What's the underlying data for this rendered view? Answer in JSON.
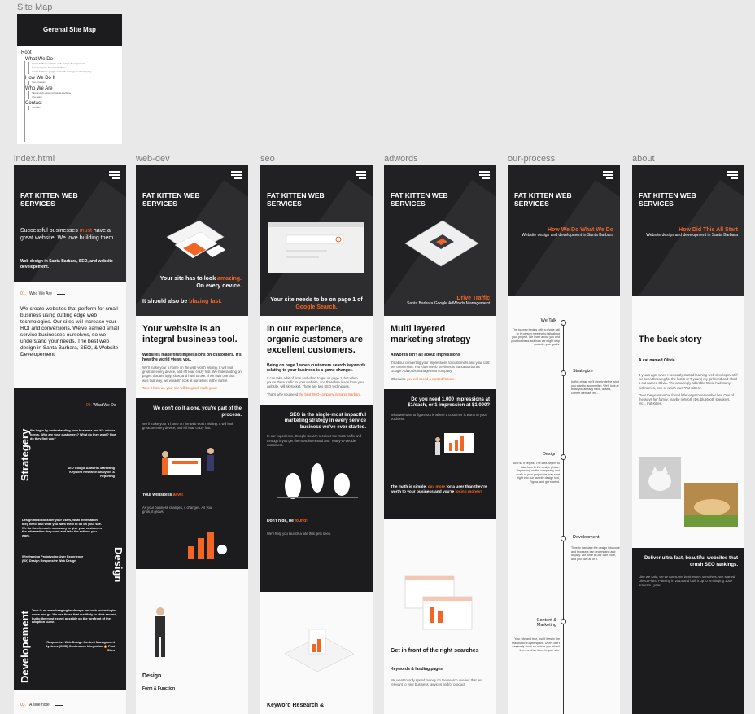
{
  "frames": {
    "site_map_label": "Site Map",
    "index_label": "index.html",
    "webdev_label": "web-dev",
    "seo_label": "seo",
    "adwords_label": "adwords",
    "process_label": "our-process",
    "about_label": "about"
  },
  "sitemap": {
    "title": "Gerenal Site Map",
    "root": "Root",
    "sections": [
      {
        "title": "What We Do",
        "pages": [
          "/santa-barbara-custom-web-design-development",
          "/seo-company-in-santa-barbara",
          "/santa-barbara-google-adwords-management-company"
        ]
      },
      {
        "title": "How We Do It",
        "pages": [
          "/our-process"
        ]
      },
      {
        "title": "Who We Are",
        "pages": [
          "/about-web-design-in-santa-barbara",
          "/the-team"
        ]
      },
      {
        "title": "Contact",
        "pages": [
          "/contact"
        ]
      }
    ]
  },
  "brand": {
    "name": "FAT KITTEN WEB SERVICES",
    "accent": "#f26522",
    "dark": "#1c1c1e"
  },
  "index": {
    "hero_lead_1": "Successful businesses ",
    "hero_lead_hl": "must",
    "hero_lead_2": " have a great website.  We love building them.",
    "hero_sub": "Web design in Santa Barbara, SEO, and website developement.",
    "s1_num": "01.",
    "s1_title": "Who We Are",
    "s1_text": "We create websites that perform for small business using cutting edge web technologies.  Our sites will increase your ROI and conversions.  We've earned small service businesses ourselves, so we understand your needs.  The best web design in Santa Barbara, SEO, & Website Developement.",
    "s2_num": "02.",
    "s2_title": "What We Do",
    "strategy": "Strategery",
    "design": "Design",
    "development": "Developement",
    "s3_num": "03.",
    "s3_title": "A side note",
    "strategy_text": "We begin by understanding your business and it's unique needs.  Who are your customers? What do they want?  How do they find you?",
    "strategy_list": "SEO Google Adwords Marketing Keyword Research Analytics & Reporting",
    "design_text": "Design must consider your users, what information they need, and what you want them to do on your site.  We do the elements necessary to give your customers the information they need and take the actions you want.",
    "design_list": "Wireframing Prototyping User Experience (UX) Design Responsive Web Design",
    "dev_text": "Tech is an everchanging landscape and web technologies come and go.  We use those that are likely to stick around, but to the most extent possible on the forefront of the adoption curve.",
    "dev_list": "Responsive Web Design Content Management Systems (CMS) Continuous Integration 🔥 Fast Sites"
  },
  "webdev": {
    "caption_1": "Your site has to look ",
    "caption_hl": "amazing.",
    "caption_2": "On every device.",
    "caption_3": "It should also be ",
    "caption_3_hl": "blazing fast.",
    "heading": "Your website is an integral business tool.",
    "sub": "Websites make first impressions on customers.  It's how the world views you.",
    "para": "We'll make your a home on the web worth visiting.  It will look great on every device, and it'll load crazy fast.  We hate landing on pages that are ugly, slow, and hard to use.  If we built one that was that way, we wouldn't look at ourselves in the mirror.",
    "link": "Take it from us, your site will be good, really good.",
    "dark_title": "We don't do it alone, you're part of the process.",
    "dark_text": "We'll make your a home on the web worth visiting.  It will look great on every device, and it'll load crazy fast.",
    "alive_1": "Your website is ",
    "alive_hl": "alive!",
    "alive_text": "As your business changes, it changes.  As you grow, it grows.",
    "design_title": "Design",
    "form_title": "Form & Function"
  },
  "seo": {
    "caption_1": "Your site needs to be on page 1 of ",
    "caption_hl": "Google Search.",
    "heading": "In our experience, organic customers are excellent customers.",
    "sub": "Being on page 1 when customers search keywords relating to your business is a game changer.",
    "para": "It can take a bit of time and effort to get on page 1, but when you're there traffic to your website, and therefore leads from your website, will skyrocket.  There are two SEO techniques.",
    "link_1": "That's why you need ",
    "link_hl": "the best SEO company in Santa Barbara.",
    "dark_title": "SEO is the single-most impactful marketing strategy in every service business we've ever started.",
    "dark_text": "In our experience, Google Search receives the most traffic and through it you get the most interested and \"ready-to-decide\" customers.",
    "fooled_1": "Don't hide, be ",
    "fooled_hl": "found!",
    "fooled_text": "We'll help you launch a site that gets seen.",
    "kw_title": "Keyword Research &"
  },
  "adwords": {
    "drive": "Drive Traffic",
    "drive_sub": "Santa Barbara Google AdWords Management",
    "heading": "Multi layered marketing strategy",
    "sub": "Adwords isn't all about impressions",
    "para": "It's about converting your impressions to customers and your cost per conversion.  Fat Kitten Web Services is Santa Barbara's Google AdWords management company.",
    "link_1": "Otherwise ",
    "link_hl": "you will spend a wasted fortune.",
    "dark_title": "Do you need 1,000 impressions at $1/each, or 1 impression at $1,000?",
    "dark_text": "What we have to figure out is where a customer is worth to your business.",
    "math_1": "The math is simple, ",
    "math_hl": "pay more",
    "math_2": " for a user than they're worth to your business and you're ",
    "math_hl2": "losing money!",
    "front_title": "Get in front of the right searches",
    "kw_title": "Keywords & landing pages",
    "kw_text": "We want to only spend money on the search queries that are relevant to your business services and/or product."
  },
  "process": {
    "title": "How We Do What We Do",
    "sub": "Website design and development in Santa Barbara",
    "steps": [
      "We Talk",
      "Strategize",
      "Design",
      "Development",
      "Content & Marketing"
    ],
    "talk_text": "The journey begins with a phone call or in person meeting to talk about your project.  We learn about you and your business and how we might help you with your goals.",
    "strat_text": "In this phase we'll clearly define what you want to accomplish.  We'll look at what you already have, assets, current website, etc...",
    "design_text": "And so it begins.  The idea begins to take form in the design phase.  Depending on the complexity and scale of your project we may start right into our favorite design tool, Figma, and get started.",
    "dev_text": "Time to translate the design into code and browsers can understand and display.  We write all our own code, and you own all of it.",
    "content_text": "Your site and tree, but it lives in the real world of cyberspace.  Users don't magically show up unless you attract them or drive them to your site."
  },
  "about": {
    "title": "How Did This All Start",
    "sub": "Website design and development in Santa Barbara",
    "heading": "The back story",
    "sub2": "A cat named Olivia...",
    "para": "3 years ago, when I seriously started learning web development if we been throwing for the last 6 or 7 years) my girlfriend and I had a cat named Olivia.  The amazingly adorable Olivia had many nicknames, one of which was \"Fat Kitten\".",
    "para2": "Over the years we've found little ways to remember her.  One of the ways her family, maybe network IDs, bluetooth speakers, etc...  Fat Kitten.",
    "dark_title": "Deliver ultra fast, beautiful websites that crush SEO rankings.",
    "dark_text": "Like we said, we've run some businesses ourselves.  We started Direct Piano Painting in 2014 and built it up to employing 100+ projects / year."
  }
}
